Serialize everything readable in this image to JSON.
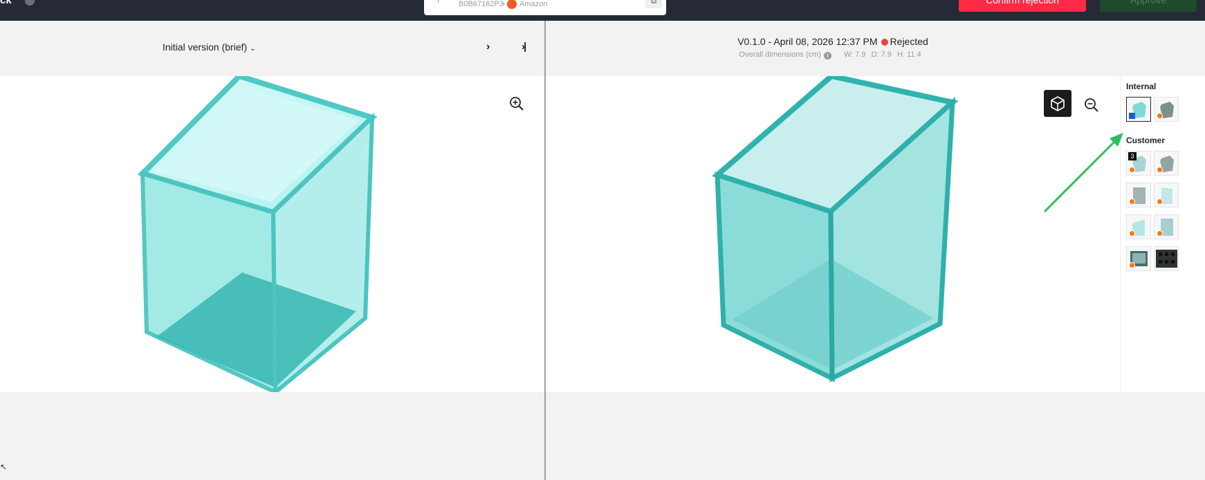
{
  "header": {
    "brand": "ck",
    "search": {
      "asin": "B0B67162P3",
      "separator": "•",
      "marketplace": "Amazon"
    },
    "reject_label": "Confirm rejection",
    "approve_label": "Approve"
  },
  "left_panel": {
    "version_label": "Initial version (brief)"
  },
  "right_panel": {
    "version": "V0.1.0 - April 08, 2026 12:37 PM",
    "status": "Rejected",
    "status_color": "#f04141",
    "dims_label": "Overall dimensions (cm)",
    "dims": {
      "w": "W: 7.9",
      "d": "D: 7.9",
      "h": "H: 11.4"
    }
  },
  "thumbnails": {
    "internal_title": "Internal",
    "customer_title": "Customer",
    "customer_badge": "3"
  },
  "colors": {
    "accent_red": "#ff2b46",
    "approve_green": "#1f4a2c",
    "topbar": "#262a37",
    "glass": "#5fd3d0"
  }
}
